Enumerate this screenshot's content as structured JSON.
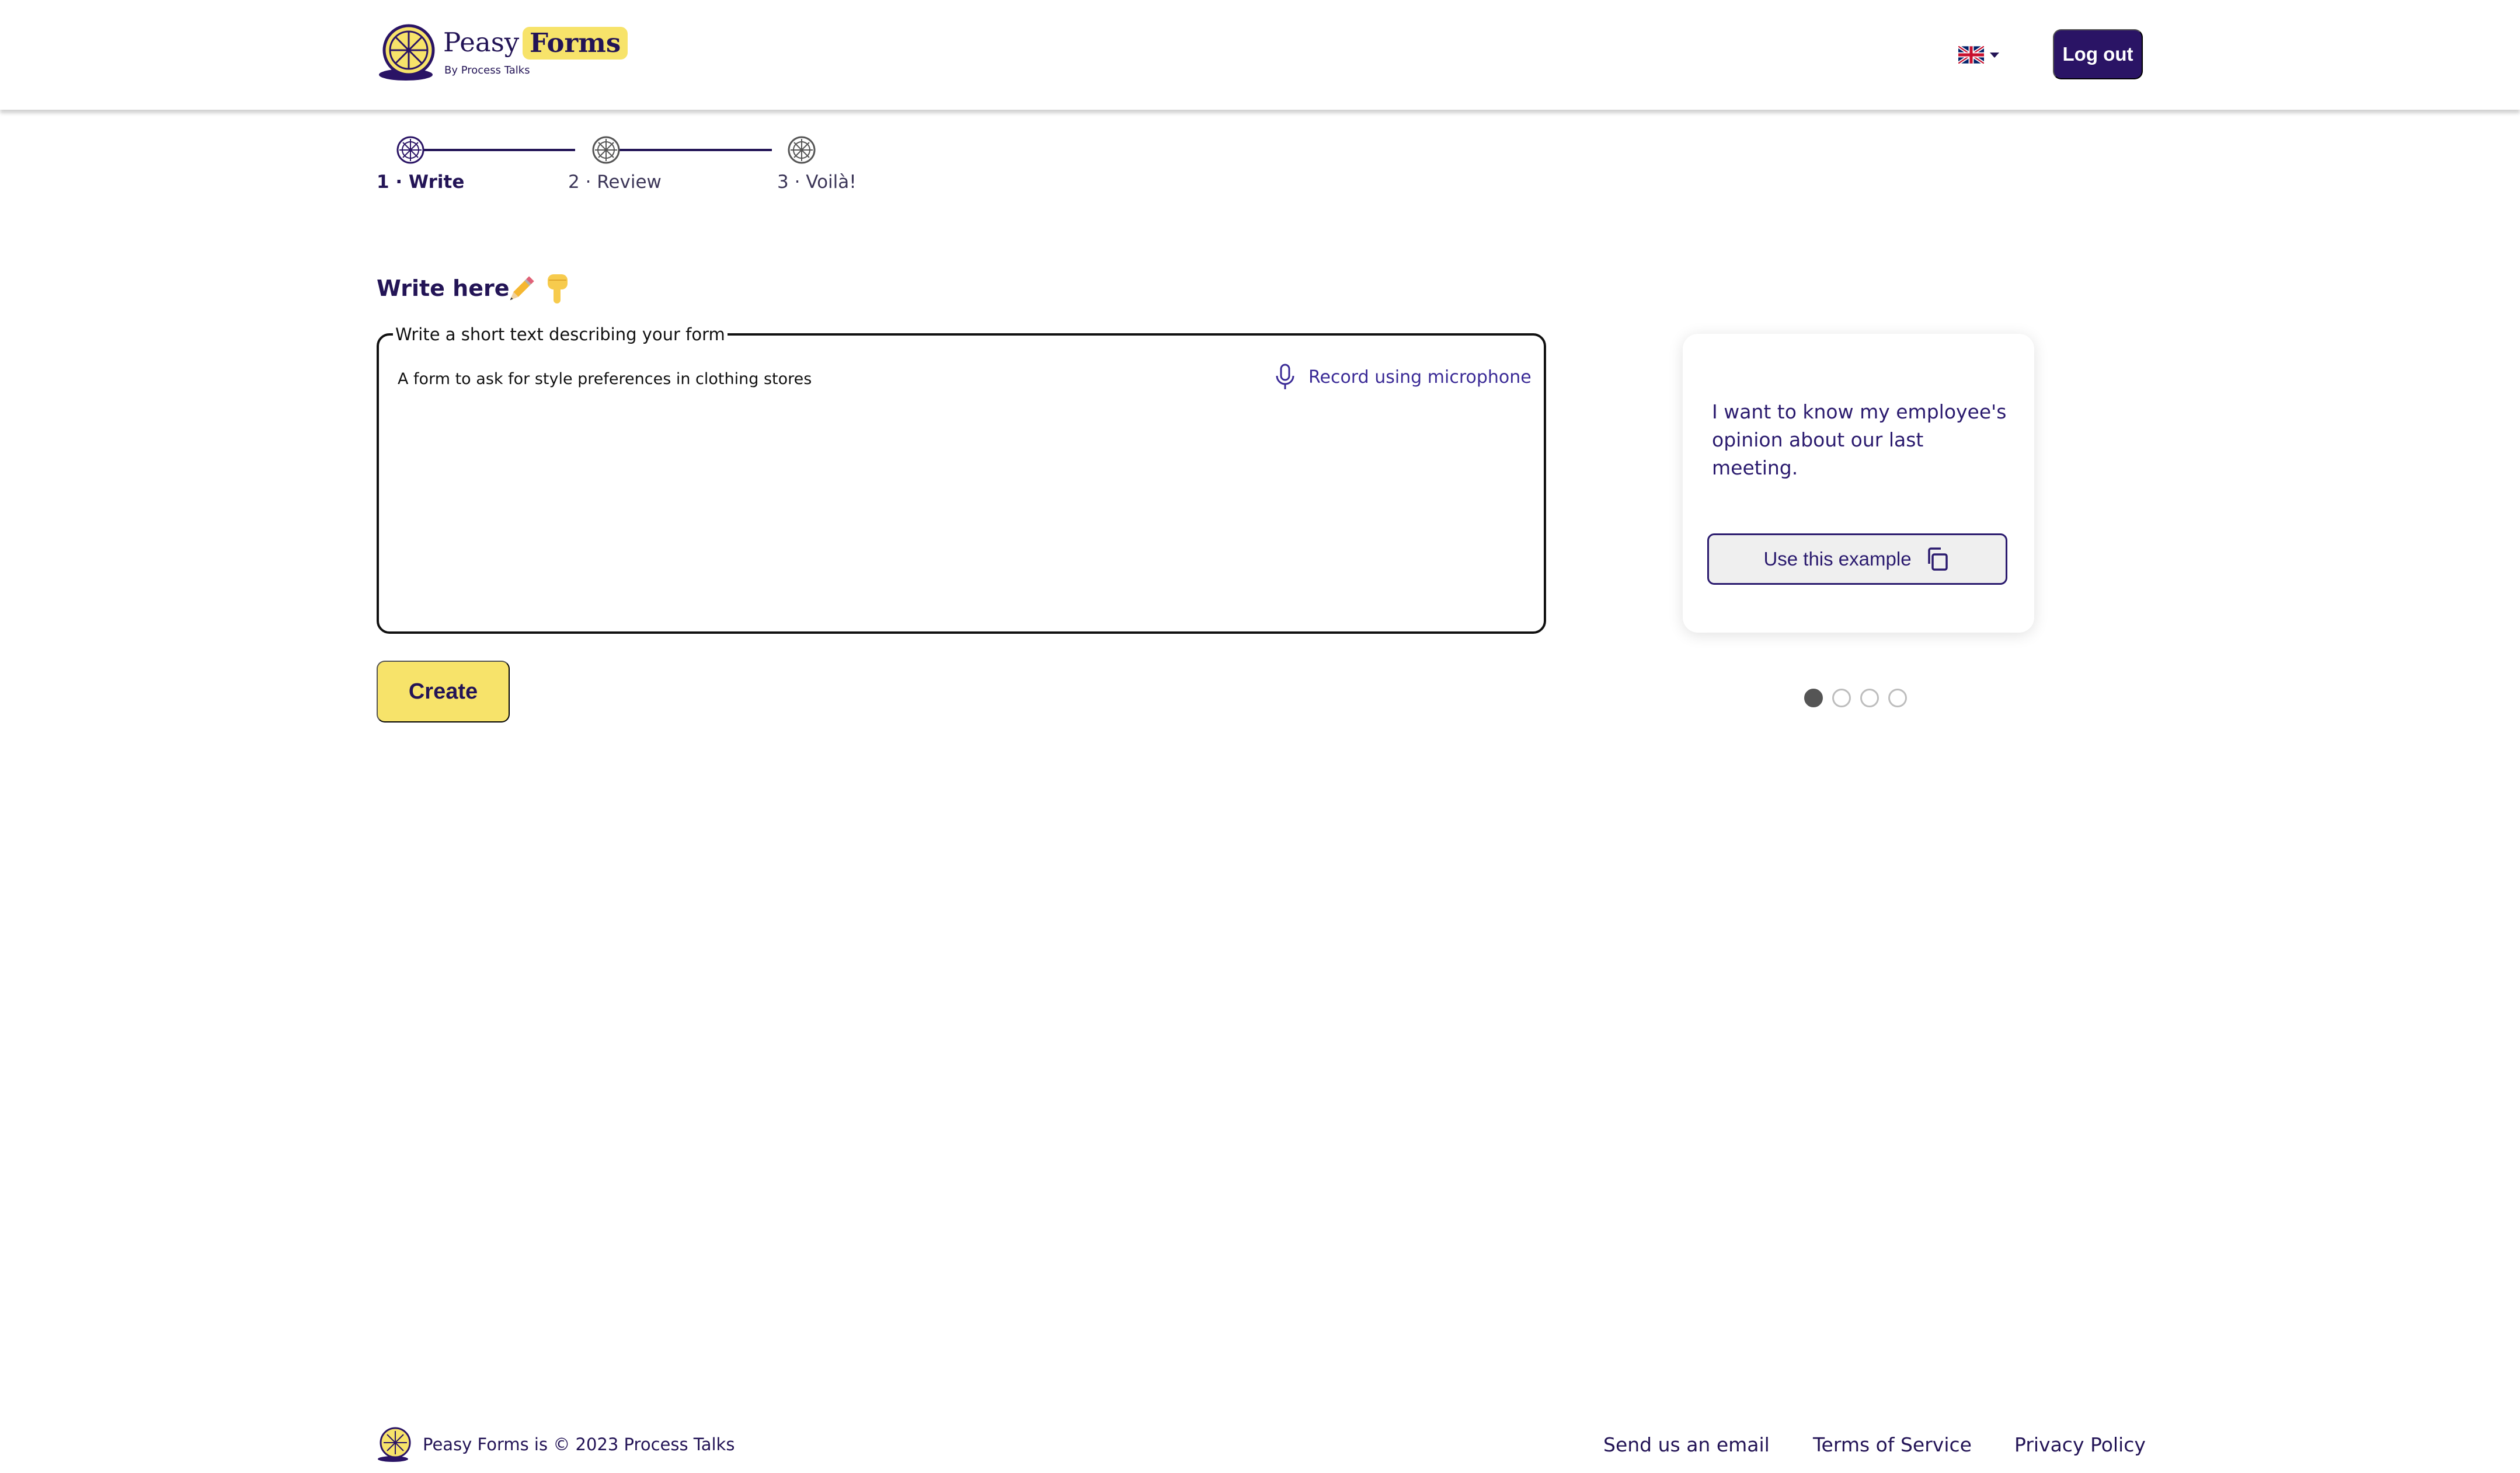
{
  "header": {
    "brand_name_1": "Peasy",
    "brand_name_2": "Forms",
    "brand_sub": "By Process Talks",
    "language_icon": "uk-flag-icon",
    "logout_label": "Log out"
  },
  "steps": [
    {
      "label": "1 · Write",
      "active": true
    },
    {
      "label": "2 · Review",
      "active": false
    },
    {
      "label": "3 · Voilà!",
      "active": false
    }
  ],
  "write": {
    "heading": "Write here",
    "field_legend": "Write a short text describing your form",
    "field_value": "A form to ask for style preferences in clothing stores",
    "mic_label": "Record using microphone",
    "create_label": "Create"
  },
  "example": {
    "text": "I want to know my employee's opinion about our last meeting.",
    "use_label": "Use this example",
    "dots": 4,
    "active_dot": 0
  },
  "footer": {
    "copyright": "Peasy Forms is © 2023 Process Talks",
    "links": [
      "Send us an email",
      "Terms of Service",
      "Privacy Policy"
    ]
  },
  "colors": {
    "primary": "#2a1465",
    "accent_yellow": "#f7e36a",
    "text": "#231456"
  }
}
